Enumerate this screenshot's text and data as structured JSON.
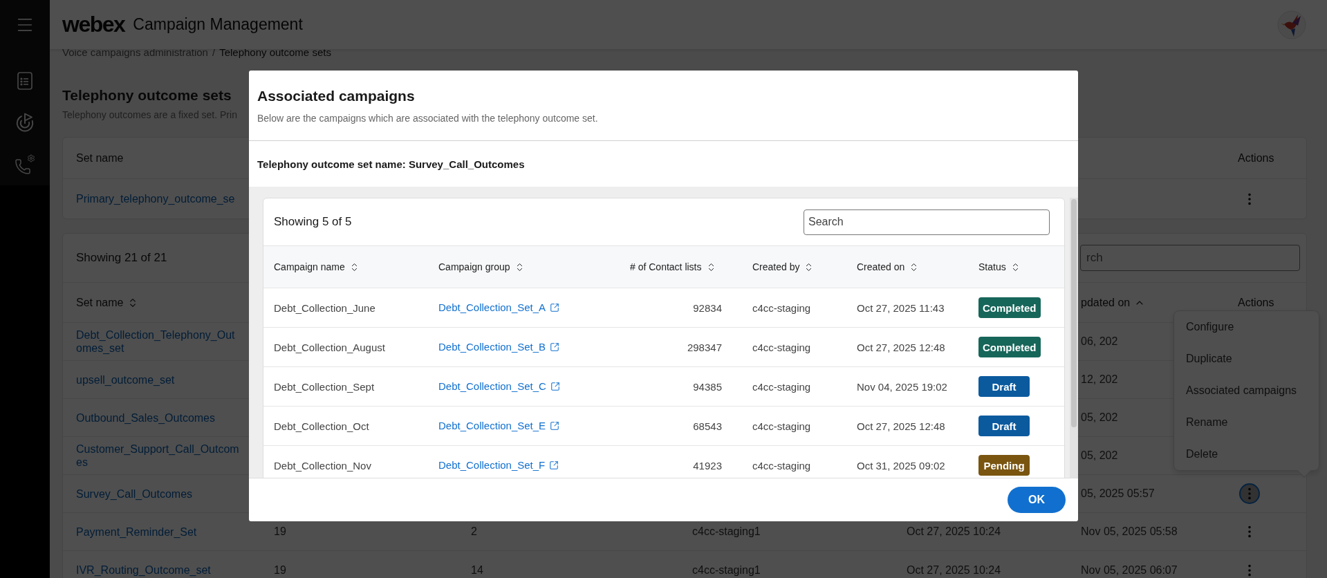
{
  "header": {
    "logo": "webex",
    "app_name": "Campaign Management"
  },
  "breadcrumb": {
    "items": [
      "Voice campaigns administration",
      "Telephony outcome sets"
    ],
    "separator": "/"
  },
  "page": {
    "title": "Telephony outcome sets",
    "description": "Telephony outcomes are a fixed set. Prin"
  },
  "primary_table": {
    "columns": [
      "Set name",
      "Actions"
    ],
    "rows": [
      {
        "set_name": [
          "Primary_telephony_outcome_se"
        ]
      }
    ]
  },
  "sets_table": {
    "count": "Showing 21 of 21",
    "search": {
      "placeholder": "rch"
    },
    "columns": [
      {
        "label": "Set name",
        "kind": "sortable"
      },
      {
        "label": "pdated on",
        "kind": "sorted"
      },
      {
        "label": "Actions",
        "kind": "plain"
      }
    ],
    "rows": [
      {
        "set_name": [
          "Debt_Collection_Telephony_Out",
          "omes_set"
        ],
        "updated_on": "06, 202",
        "menu_open": false
      },
      {
        "set_name": [
          "upsell_outcome_set"
        ],
        "updated_on": "12, 202",
        "menu_open": false
      },
      {
        "set_name": [
          "Outbound_Sales_Outcomes"
        ],
        "updated_on": "05, 202",
        "menu_open": false
      },
      {
        "set_name": [
          "Customer_Support_Call_Outcom",
          "es"
        ],
        "updated_on": "05, 202",
        "menu_open": false
      },
      {
        "set_name": [
          "Survey_Call_Outcomes"
        ],
        "updated_on": "05, 2025 05:57",
        "menu_open": true
      },
      {
        "set_name": [
          "Payment_Reminder_Set"
        ],
        "column_2": "19",
        "column_3": "2",
        "column_4": "c4cc-staging1",
        "column_5": "Oct 27, 2025 10:24",
        "updated_on": "Nov 05, 2025 05:58",
        "menu_open": false
      },
      {
        "set_name": [
          "IVR_Routing_Outcome_set"
        ],
        "column_2": "19",
        "column_3": "14",
        "column_4": "c4cc-staging1",
        "column_5": "Oct 27, 2025 10:24",
        "updated_on": "Nov 05, 2025 06:07",
        "menu_open": false
      }
    ]
  },
  "action_menu": {
    "items": [
      "Configure",
      "Duplicate",
      "Associated campaigns",
      "Rename",
      "Delete"
    ]
  },
  "modal": {
    "title": "Associated campaigns",
    "description": "Below are the campaigns which are associated with the telephony outcome set.",
    "set_name_label": "Telephony outcome set name: Survey_Call_Outcomes",
    "count": "Showing 5 of 5",
    "search": {
      "placeholder": "Search"
    },
    "columns": [
      "Campaign name",
      "Campaign group",
      "# of Contact lists",
      "Created by",
      "Created on",
      "Status"
    ],
    "rows": [
      {
        "campaign_name": "Debt_Collection_June",
        "campaign_group": "Debt_Collection_Set_A",
        "contact_lists": "92834",
        "created_by": "c4cc-staging",
        "created_on": "Oct 27, 2025 11:43",
        "status": {
          "label": "Completed",
          "kind": "completed"
        }
      },
      {
        "campaign_name": "Debt_Collection_August",
        "campaign_group": "Debt_Collection_Set_B",
        "contact_lists": "298347",
        "created_by": "c4cc-staging",
        "created_on": "Oct 27, 2025 12:48",
        "status": {
          "label": "Completed",
          "kind": "completed"
        }
      },
      {
        "campaign_name": "Debt_Collection_Sept",
        "campaign_group": "Debt_Collection_Set_C",
        "contact_lists": "94385",
        "created_by": "c4cc-staging",
        "created_on": "Nov 04, 2025 19:02",
        "status": {
          "label": "Draft",
          "kind": "draft"
        }
      },
      {
        "campaign_name": "Debt_Collection_Oct",
        "campaign_group": "Debt_Collection_Set_E",
        "contact_lists": "68543",
        "created_by": "c4cc-staging",
        "created_on": "Oct 27, 2025 12:48",
        "status": {
          "label": "Draft",
          "kind": "draft"
        }
      },
      {
        "campaign_name": "Debt_Collection_Nov",
        "campaign_group": "Debt_Collection_Set_F",
        "contact_lists": "41923",
        "created_by": "c4cc-staging",
        "created_on": "Oct 31, 2025 09:02",
        "status": {
          "label": "Pending",
          "kind": "pending"
        }
      }
    ],
    "ok_button": "OK"
  }
}
